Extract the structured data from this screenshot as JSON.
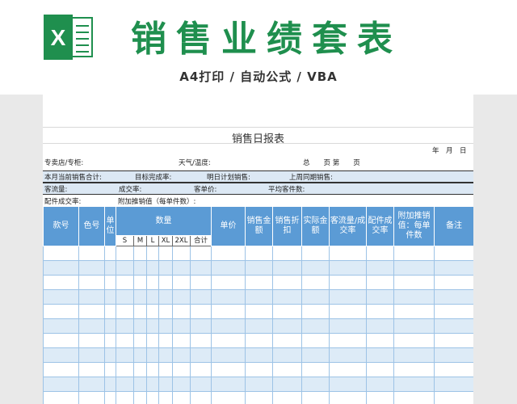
{
  "banner": {
    "title": "销售业绩套表",
    "subtitle": "A4打印 / 自动公式 / VBA",
    "logo_letter": "X",
    "logo_color": "#1f8f4e"
  },
  "report": {
    "title": "销售日报表",
    "date_label": "年　月　日",
    "store_label": "专卖店/专柜:",
    "weather_label": "天气/温度:",
    "pages_label": "总　　页 第　　页",
    "row1": {
      "a": "本月当前销售合计:",
      "b": "目标完成率:",
      "c": "明日计划销售:",
      "d": "上周同期销售:"
    },
    "row2": {
      "a": "客流量:",
      "b": "成交率:",
      "c": "客单价:",
      "d": "平均客件数:"
    },
    "row3": {
      "a": "配件成交率:",
      "b": "附加推销值（每单件数）:"
    }
  },
  "table": {
    "headers": {
      "item_no": "款号",
      "color_no": "色号",
      "unit": "单位",
      "quantity": "数量",
      "unit_price": "单价",
      "sales_amount": "销售金额",
      "sales_discount": "销售折扣",
      "actual_amount": "实际金额",
      "traffic_rate": "客流量/成交率",
      "accessory_rate": "配件成交率",
      "addon_value": "附加推销值：每单件数",
      "remarks": "备注"
    },
    "sizes": [
      "S",
      "M",
      "L",
      "XL",
      "2XL",
      "合计"
    ],
    "row_count": 11
  },
  "colors": {
    "brand_green": "#1f8f4e",
    "header_blue": "#5b9bd5",
    "row_band": "#ddebf7"
  }
}
